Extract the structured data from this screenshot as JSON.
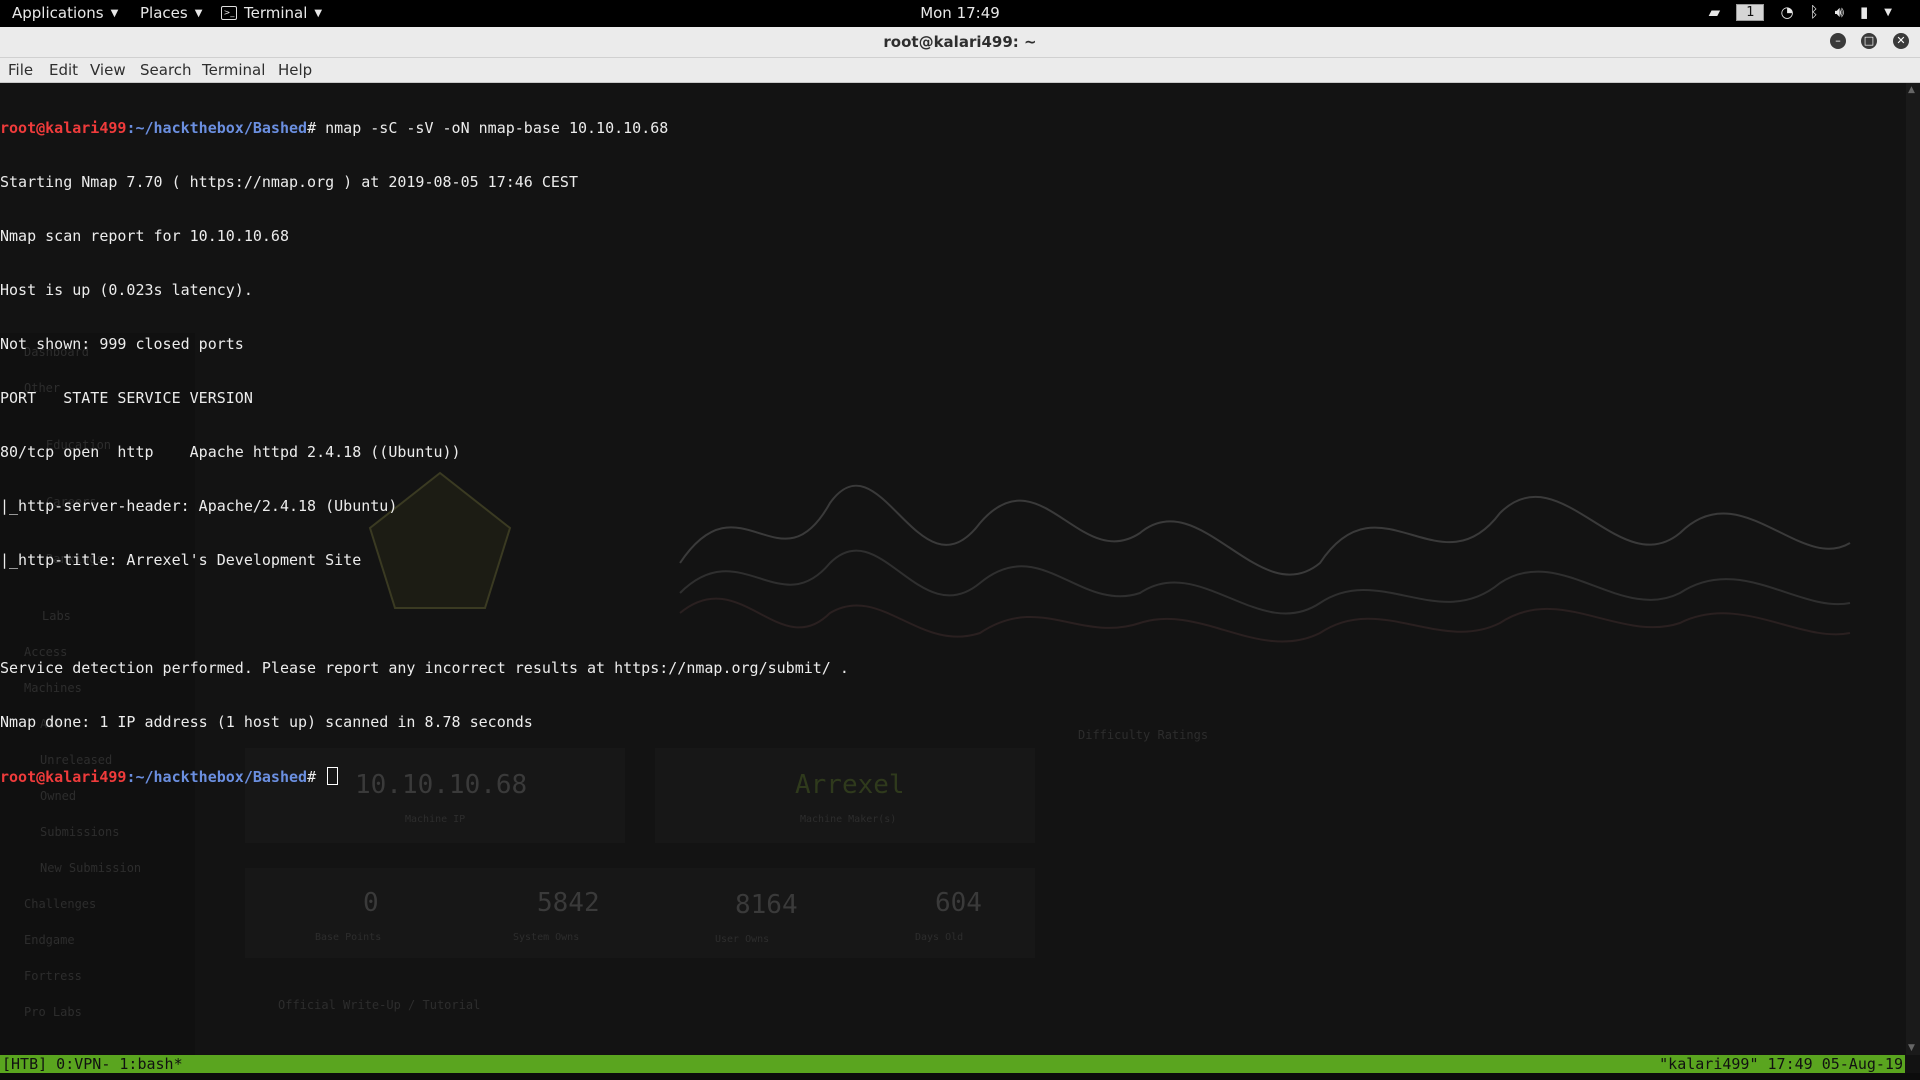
{
  "topbar": {
    "applications": "Applications",
    "places": "Places",
    "terminal": "Terminal",
    "clock": "Mon 17:49",
    "workspace": "1"
  },
  "window": {
    "title": "root@kalari499: ~",
    "menu": [
      "File",
      "Edit",
      "View",
      "Search",
      "Terminal",
      "Help"
    ]
  },
  "terminal": {
    "prompt_user": "root@kalari499",
    "prompt_path": ":~/hackthebox/Bashed",
    "prompt_symbol": "# ",
    "command": "nmap -sC -sV -oN nmap-base 10.10.10.68",
    "output": [
      "Starting Nmap 7.70 ( https://nmap.org ) at 2019-08-05 17:46 CEST",
      "Nmap scan report for 10.10.10.68",
      "Host is up (0.023s latency).",
      "Not shown: 999 closed ports",
      "PORT   STATE SERVICE VERSION",
      "80/tcp open  http    Apache httpd 2.4.18 ((Ubuntu))",
      "|_http-server-header: Apache/2.4.18 (Ubuntu)",
      "|_http-title: Arrexel's Development Site",
      "",
      "Service detection performed. Please report any incorrect results at https://nmap.org/submit/ .",
      "Nmap done: 1 IP address (1 host up) scanned in 8.78 seconds"
    ]
  },
  "background": {
    "machine_ip": "10.10.10.68",
    "machine_ip_label": "Machine IP",
    "maker": "Arrexel",
    "maker_label": "Machine Maker(s)",
    "base_points": "0",
    "base_points_label": "Base Points",
    "system_owns": "5842",
    "system_label": "System Owns",
    "user_owns": "8164",
    "user_label": "User Owns",
    "days": "604",
    "days_label": "Days Old",
    "difficulty": "Difficulty Ratings",
    "writeup": "Official Write-Up / Tutorial",
    "sidebar": [
      "Dashboard",
      "Other",
      "Education",
      "Careers",
      "Rankings",
      "Labs",
      "Access",
      "Machines",
      "All",
      "Unreleased",
      "Owned",
      "Submissions",
      "New Submission",
      "Challenges",
      "Endgame",
      "Fortress",
      "Pro Labs"
    ]
  },
  "status": {
    "left": "[HTB] 0:VPN- 1:bash*",
    "right": "\"kalari499\" 17:49 05-Aug-19"
  },
  "colors": {
    "prompt_user": "#ef3b3b",
    "prompt_path": "#6b8fe0",
    "status_bar": "#5aa51f"
  }
}
